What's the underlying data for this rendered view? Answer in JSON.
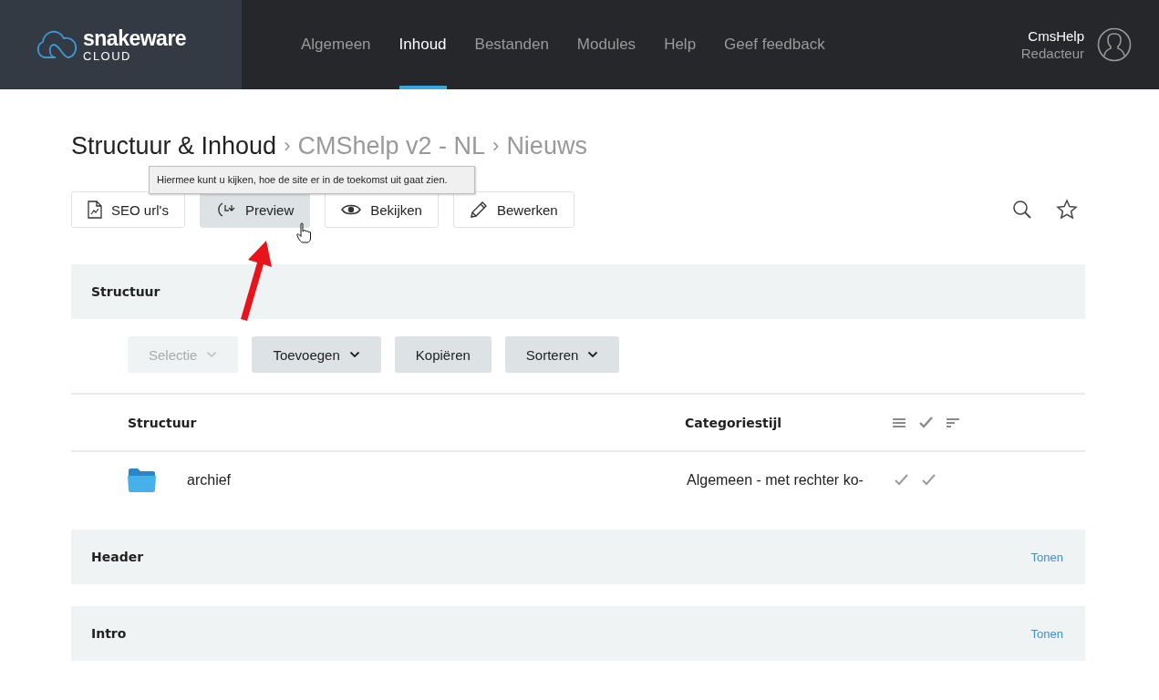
{
  "brand": {
    "name": "snakeware",
    "sub": "CLOUD"
  },
  "nav": [
    {
      "label": "Algemeen",
      "selected": false
    },
    {
      "label": "Inhoud",
      "selected": true
    },
    {
      "label": "Bestanden",
      "selected": false
    },
    {
      "label": "Modules",
      "selected": false
    },
    {
      "label": "Help",
      "selected": false
    },
    {
      "label": "Geef feedback",
      "selected": false
    }
  ],
  "user": {
    "name": "CmsHelp",
    "role": "Redacteur"
  },
  "breadcrumb": [
    {
      "label": "Structuur & Inhoud",
      "current": true
    },
    {
      "label": "CMShelp v2 - NL",
      "current": false
    },
    {
      "label": "Nieuws",
      "current": false
    }
  ],
  "breadcrumb_separator": "›",
  "actions": [
    {
      "label": "SEO url's",
      "kind": "chart",
      "hover": false
    },
    {
      "label": "Preview",
      "kind": "clock",
      "hover": true
    },
    {
      "label": "Bekijken",
      "kind": "eye",
      "hover": false
    },
    {
      "label": "Bewerken",
      "kind": "pencil",
      "hover": false
    }
  ],
  "tooltip": "Hiermee kunt u kijken, hoe de site er in de toekomst uit gaat zien.",
  "structure": {
    "title": "Structuur",
    "toolbar": [
      {
        "label": "Selectie",
        "kind": "dropdown",
        "disabled": true
      },
      {
        "label": "Toevoegen",
        "kind": "dropdown",
        "disabled": false
      },
      {
        "label": "Kopiëren",
        "kind": "plain",
        "disabled": false
      },
      {
        "label": "Sorteren",
        "kind": "dropdown",
        "disabled": false
      }
    ],
    "table": {
      "columns": [
        "Structuur",
        "Categoriestijl"
      ],
      "rows": [
        {
          "name": "archief",
          "style": "Algemeen - met rechter ko-",
          "flags": [
            {
              "checked": true
            },
            {
              "checked": true
            }
          ]
        }
      ]
    }
  },
  "sections": [
    {
      "title": "Header",
      "link": "Tonen"
    },
    {
      "title": "Intro",
      "link": "Tonen"
    }
  ]
}
